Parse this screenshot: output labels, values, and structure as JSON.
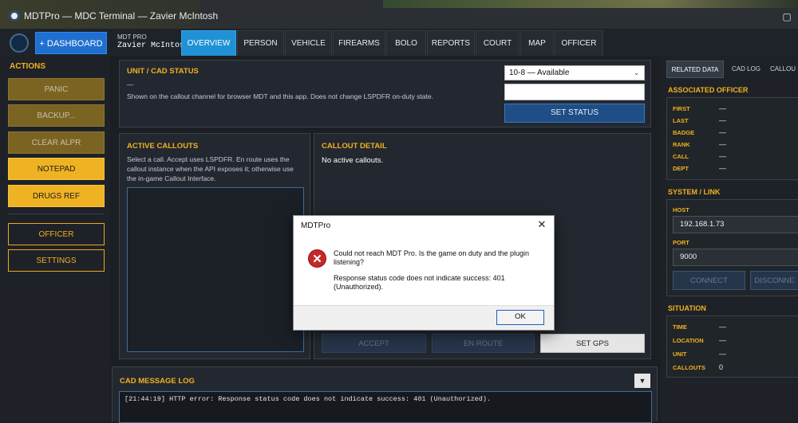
{
  "window": {
    "title": "MDTPro — MDC Terminal — Zavier McIntosh",
    "restore_glyph": "▢"
  },
  "nav": {
    "dashboard_label": "+ DASHBOARD",
    "user_small": "MDT PRO",
    "user_name": "Zavier McIntosh",
    "tabs": [
      {
        "label": "OVERVIEW",
        "active": true
      },
      {
        "label": "PERSON"
      },
      {
        "label": "VEHICLE"
      },
      {
        "label": "FIREARMS"
      },
      {
        "label": "BOLO"
      },
      {
        "label": "REPORTS"
      },
      {
        "label": "COURT"
      },
      {
        "label": "MAP"
      },
      {
        "label": "OFFICER"
      }
    ]
  },
  "actions": {
    "heading": "ACTIONS",
    "panic": "PANIC",
    "backup": "BACKUP...",
    "clear_alpr": "CLEAR ALPR",
    "notepad": "NOTEPAD",
    "drugs_ref": "DRUGS REF",
    "officer": "OFFICER",
    "settings": "SETTINGS"
  },
  "unit_status": {
    "title": "UNIT / CAD STATUS",
    "dash": "—",
    "description": "Shown on the callout channel for browser MDT and this app. Does not change LSPDFR on-duty state.",
    "selected_status": "10-8 — Available",
    "custom_value": "",
    "set_status_label": "SET STATUS"
  },
  "active_callouts": {
    "title": "ACTIVE CALLOUTS",
    "description": "Select a call. Accept uses LSPDFR. En route uses the callout instance when the API exposes it; otherwise use the in-game Callout Interface."
  },
  "callout_detail": {
    "title": "CALLOUT DETAIL",
    "text": "No active callouts.",
    "accept_label": "ACCEPT",
    "enroute_label": "EN ROUTE",
    "setgps_label": "SET GPS"
  },
  "cad_log": {
    "title": "CAD MESSAGE LOG",
    "collapse_glyph": "▼",
    "lines": [
      "[21:44:19] HTTP error: Response status code does not indicate success: 401 (Unauthorized)."
    ]
  },
  "right": {
    "tabs": [
      "RELATED DATA",
      "CAD LOG",
      "CALLOU"
    ],
    "associated_officer": {
      "title": "ASSOCIATED OFFICER",
      "fields": [
        {
          "label": "FIRST",
          "value": "—"
        },
        {
          "label": "LAST",
          "value": "—"
        },
        {
          "label": "BADGE",
          "value": "—"
        },
        {
          "label": "RANK",
          "value": "—"
        },
        {
          "label": "CALL",
          "value": "—"
        },
        {
          "label": "DEPT",
          "value": "—"
        }
      ]
    },
    "system_link": {
      "title": "SYSTEM / LINK",
      "host_label": "HOST",
      "host_value": "192.168.1.73",
      "port_label": "PORT",
      "port_value": "9000",
      "connect_label": "CONNECT",
      "disconnect_label": "DISCONNE"
    },
    "situation": {
      "title": "SITUATION",
      "fields": [
        {
          "label": "TIME",
          "value": "—"
        },
        {
          "label": "LOCATION",
          "value": "—"
        },
        {
          "label": "UNIT",
          "value": "—"
        },
        {
          "label": "CALLOUTS",
          "value": "0"
        }
      ]
    }
  },
  "dialog": {
    "title": "MDTPro",
    "close_glyph": "✕",
    "icon_glyph": "✕",
    "message1": "Could not reach MDT Pro. Is the game on duty and the plugin listening?",
    "message2": "Response status code does not indicate success: 401 (Unauthorized).",
    "ok_label": "OK"
  }
}
